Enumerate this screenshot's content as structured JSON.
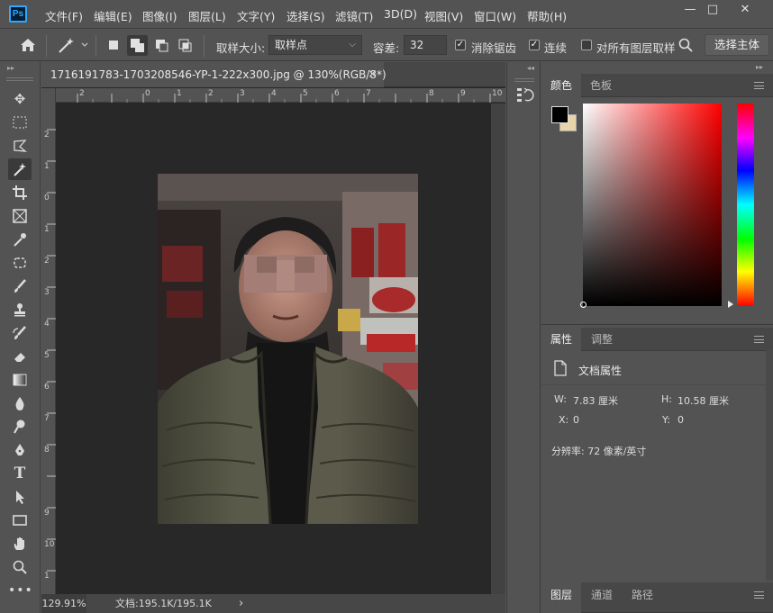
{
  "app": {
    "logo": "Ps"
  },
  "menu": [
    "文件(F)",
    "编辑(E)",
    "图像(I)",
    "图层(L)",
    "文字(Y)",
    "选择(S)",
    "滤镜(T)",
    "3D(D)",
    "视图(V)",
    "窗口(W)",
    "帮助(H)"
  ],
  "window_controls": {
    "minimize": "—",
    "maximize": "□",
    "close": "✕"
  },
  "options": {
    "sample_size_label": "取样大小:",
    "sample_size_value": "取样点",
    "tolerance_label": "容差:",
    "tolerance_value": "32",
    "antialias_label": "消除锯齿",
    "antialias_checked": true,
    "contiguous_label": "连续",
    "contiguous_checked": true,
    "all_layers_label": "对所有图层取样",
    "all_layers_checked": false,
    "select_subject_label": "选择主体"
  },
  "document": {
    "tab_title": "1716191783-1703208546-YP-1-222x300.jpg @ 130%(RGB/8*)",
    "tab_close": "×",
    "ruler_h": [
      "2",
      "0",
      "1",
      "2",
      "3",
      "4",
      "5",
      "6",
      "7",
      "8",
      "9",
      "10"
    ],
    "ruler_v": [
      "2",
      "1",
      "0",
      "1",
      "2",
      "3",
      "4",
      "5",
      "6",
      "7",
      "8",
      "9",
      "10",
      "1"
    ],
    "zoom": "129.91%",
    "doc_size": "文档:195.1K/195.1K",
    "status_arrow": "›"
  },
  "tools": [
    "move-tool",
    "marquee-tool",
    "lasso-tool",
    "magic-wand-tool",
    "crop-tool",
    "frame-tool",
    "eyedropper-tool",
    "patch-tool",
    "brush-tool",
    "stamp-tool",
    "history-brush-tool",
    "eraser-tool",
    "gradient-tool",
    "blur-tool",
    "dodge-tool",
    "pen-tool",
    "type-tool",
    "path-select-tool",
    "rectangle-tool",
    "hand-tool",
    "zoom-tool",
    "more-tools"
  ],
  "color_panel": {
    "tabs": [
      "颜色",
      "色板"
    ],
    "foreground": "#000000",
    "background": "#e8d4a8",
    "picker_hue": "#ff0000"
  },
  "properties_panel": {
    "tabs": [
      "属性",
      "调整"
    ],
    "section": "文档属性",
    "w_label": "W:",
    "w_value": "7.83 厘米",
    "h_label": "H:",
    "h_value": "10.58 厘米",
    "x_label": "X:",
    "x_value": "0",
    "y_label": "Y:",
    "y_value": "0",
    "resolution": "分辨率: 72 像素/英寸"
  },
  "layers_panel": {
    "tabs": [
      "图层",
      "通道",
      "路径"
    ]
  }
}
